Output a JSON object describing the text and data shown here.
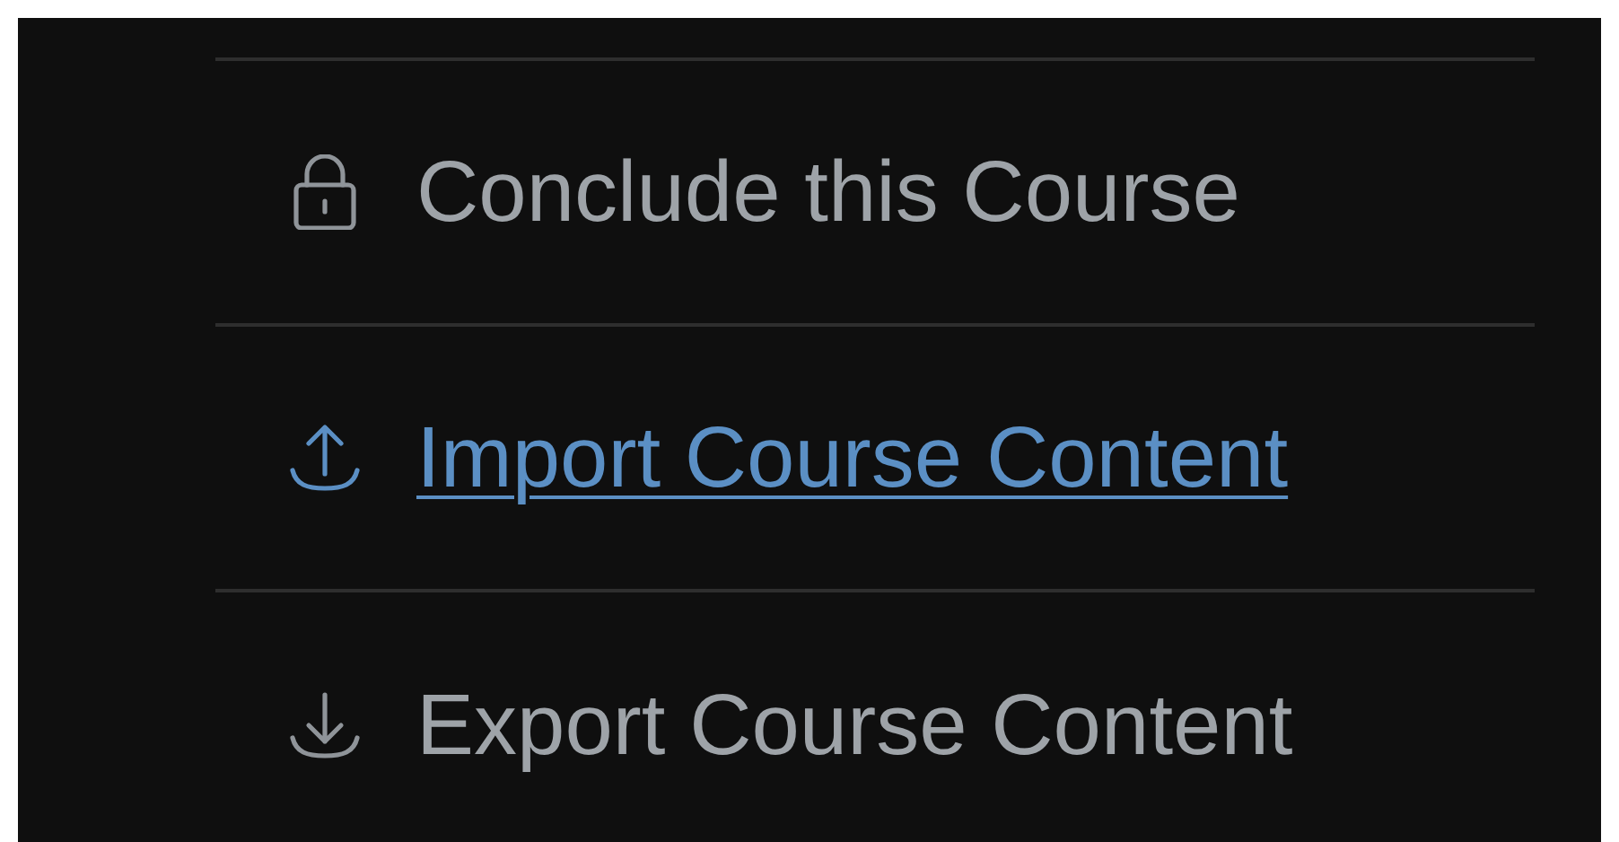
{
  "items": [
    {
      "kind": "lock",
      "label": "Conclude this Course",
      "is_link": false
    },
    {
      "kind": "upload",
      "label": "Import Course Content",
      "is_link": true
    },
    {
      "kind": "download",
      "label": "Export Course Content",
      "is_link": false
    }
  ]
}
